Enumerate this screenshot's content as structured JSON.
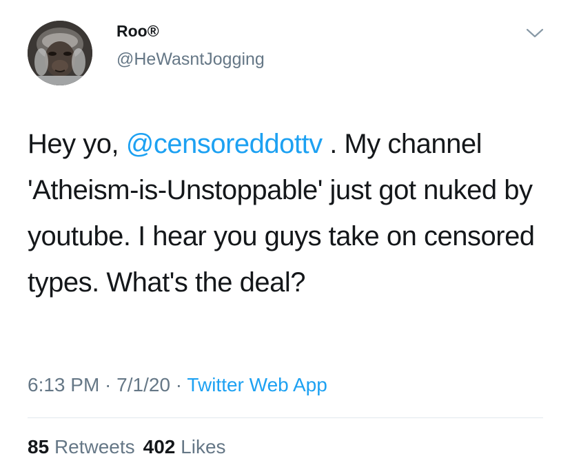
{
  "user": {
    "display_name": "Roo®",
    "handle": "@HeWasntJogging"
  },
  "tweet": {
    "text_before": "Hey yo, ",
    "mention": "@censoreddottv",
    "text_after": " . My channel 'Atheism-is-Unstoppable' just got nuked by youtube. I hear you guys take on censored types. What's the deal?"
  },
  "meta": {
    "time": "6:13 PM",
    "sep1": " · ",
    "date": "7/1/20",
    "sep2": " · ",
    "source": "Twitter Web App"
  },
  "stats": {
    "retweets_count": "85",
    "retweets_label": "Retweets",
    "likes_count": "402",
    "likes_label": "Likes"
  },
  "colors": {
    "link": "#1da1f2",
    "secondary_text": "#657786",
    "primary_text": "#14171a",
    "divider": "#e1e8ed"
  },
  "icons": {
    "menu": "chevron-down-icon",
    "avatar": "ape-face-avatar"
  }
}
